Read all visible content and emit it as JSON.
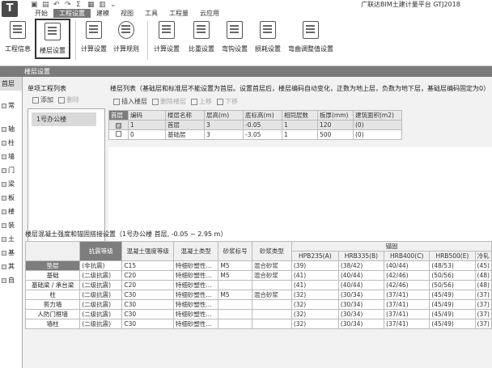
{
  "app": {
    "logo": "T",
    "title": "广联达BIM土建计量平台 GTJ2018"
  },
  "menu_tabs": [
    "开始",
    "工程设置",
    "建模",
    "视图",
    "工具",
    "工程量",
    "云应用"
  ],
  "ribbon": {
    "buttons": [
      {
        "label": "工程信息",
        "icon": "project-info-icon"
      },
      {
        "label": "楼层设置",
        "icon": "floor-settings-icon"
      },
      {
        "label": "计算设置",
        "icon": "calc-settings-icon"
      },
      {
        "label": "计算规则",
        "icon": "calc-rules-icon"
      },
      {
        "label": "计算设置",
        "icon": "calc-settings-2-icon"
      },
      {
        "label": "比重设置",
        "icon": "weight-settings-icon"
      },
      {
        "label": "弯钩设置",
        "icon": "hook-settings-icon"
      },
      {
        "label": "损耗设置",
        "icon": "loss-settings-icon"
      },
      {
        "label": "弯曲调整值设置",
        "icon": "bend-adjust-icon"
      }
    ]
  },
  "dialog": {
    "title": "楼层设置",
    "left_tabs": [
      "首层",
      "常",
      "轴",
      "柱",
      "墙",
      "门",
      "梁",
      "板",
      "楼",
      "装",
      "土",
      "基",
      "其",
      "自"
    ],
    "project_list_label": "单项工程列表",
    "project_toolbar": {
      "add": "添加",
      "delete": "删除"
    },
    "project_items": [
      "1号办公楼"
    ],
    "floor_list_label": "楼层列表（基础层和标准层不能设置为首层。设置首层后，楼层编码自动变化，正数为地上层，负数为地下层，基础层编码固定为0）",
    "floor_toolbar": {
      "insert": "插入楼层",
      "delete": "删除楼层",
      "up": "上移",
      "down": "下移"
    },
    "floor_columns": [
      "首层",
      "编码",
      "楼层名称",
      "层高(m)",
      "底标高(m)",
      "相同层数",
      "板厚(mm)",
      "建筑面积(m2)"
    ],
    "floor_rows": [
      {
        "first": true,
        "code": "1",
        "name": "首层",
        "height": "3",
        "bottom": "-0.05",
        "same": "1",
        "thickness": "120",
        "area": "(0)"
      },
      {
        "first": false,
        "code": "0",
        "name": "基础层",
        "height": "3",
        "bottom": "-3.05",
        "same": "1",
        "thickness": "500",
        "area": "(0)"
      }
    ],
    "concrete_title": "楼层混凝土强度和锚固搭接设置（1号办公楼 首层, -0.05 ~ 2.95 m）",
    "concrete_header_group": "锚固",
    "concrete_columns": [
      "抗震等级",
      "混凝土强度等级",
      "混凝土类型",
      "砂浆标号",
      "砂浆类型",
      "HPB235(A)",
      "HRB335(B)",
      "HRB400(C)",
      "HRB500(E)",
      "冷轧"
    ],
    "concrete_rows": [
      {
        "name": "垫层",
        "grade": "(非抗震)",
        "strength": "C15",
        "ctype": "特细砂塑性...",
        "mortar": "M5",
        "mtype": "混合砂浆",
        "a": "(39)",
        "b": "(38/42)",
        "c": "(40/44)",
        "e": "(48/53)",
        "f": "(45)"
      },
      {
        "name": "基础",
        "grade": "(二级抗震)",
        "strength": "C20",
        "ctype": "特细砂塑性...",
        "mortar": "M5",
        "mtype": "混合砂浆",
        "a": "(41)",
        "b": "(40/44)",
        "c": "(42/46)",
        "e": "(50/56)",
        "f": "(48)"
      },
      {
        "name": "基础梁 / 承台梁",
        "grade": "(二级抗震)",
        "strength": "C20",
        "ctype": "特细砂塑性...",
        "mortar": "",
        "mtype": "",
        "a": "(41)",
        "b": "(40/44)",
        "c": "(42/46)",
        "e": "(50/56)",
        "f": "(48)"
      },
      {
        "name": "柱",
        "grade": "(二级抗震)",
        "strength": "C30",
        "ctype": "特细砂塑性...",
        "mortar": "M5",
        "mtype": "混合砂浆",
        "a": "(32)",
        "b": "(30/34)",
        "c": "(37/41)",
        "e": "(45/49)",
        "f": "(37)"
      },
      {
        "name": "剪力墙",
        "grade": "(二级抗震)",
        "strength": "C30",
        "ctype": "特细砂塑性...",
        "mortar": "",
        "mtype": "",
        "a": "(32)",
        "b": "(30/34)",
        "c": "(37/41)",
        "e": "(45/49)",
        "f": "(37)"
      },
      {
        "name": "人防门框墙",
        "grade": "(二级抗震)",
        "strength": "C30",
        "ctype": "特细砂塑性...",
        "mortar": "",
        "mtype": "",
        "a": "(32)",
        "b": "(30/34)",
        "c": "(37/41)",
        "e": "(45/49)",
        "f": "(37)"
      },
      {
        "name": "墙柱",
        "grade": "(二级抗震)",
        "strength": "C30",
        "ctype": "特细砂塑性...",
        "mortar": "",
        "mtype": "",
        "a": "(32)",
        "b": "(30/34)",
        "c": "(37/41)",
        "e": "(45/49)",
        "f": "(37)"
      }
    ]
  }
}
